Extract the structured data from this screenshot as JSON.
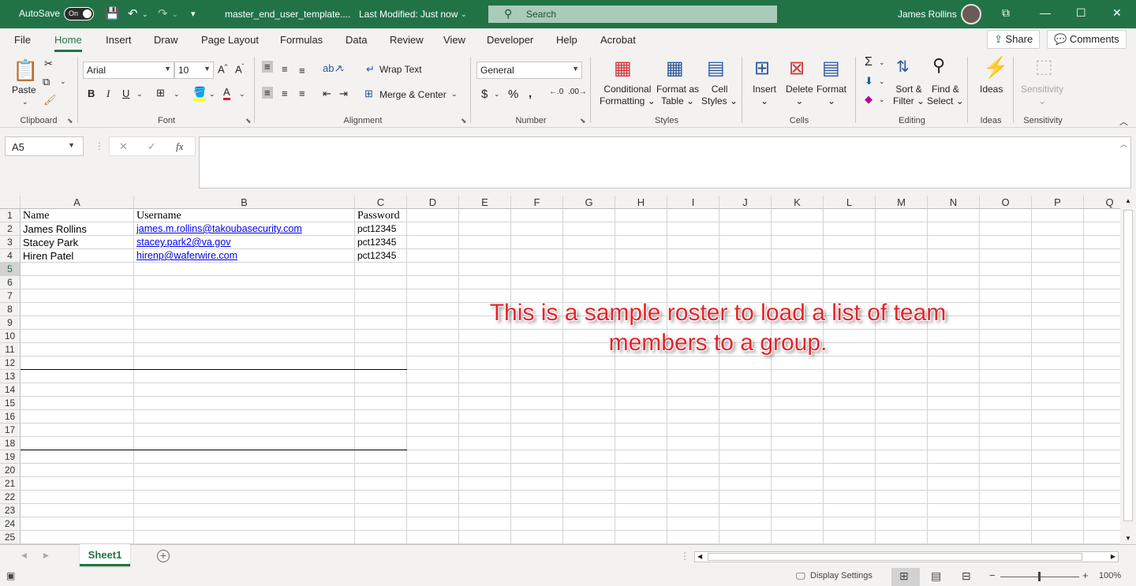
{
  "titlebar": {
    "autosave_label": "AutoSave",
    "autosave_state": "On",
    "filename": "master_end_user_template....",
    "last_modified": "Last Modified: Just now",
    "search_placeholder": "Search",
    "user_name": "James Rollins"
  },
  "menu": {
    "tabs": [
      "File",
      "Home",
      "Insert",
      "Draw",
      "Page Layout",
      "Formulas",
      "Data",
      "Review",
      "View",
      "Developer",
      "Help",
      "Acrobat"
    ],
    "active": "Home",
    "share_label": "Share",
    "comments_label": "Comments"
  },
  "ribbon": {
    "clipboard": {
      "paste": "Paste",
      "label": "Clipboard"
    },
    "font": {
      "name": "Arial",
      "size": "10",
      "label": "Font",
      "bold": "B",
      "italic": "I",
      "underline": "U"
    },
    "alignment": {
      "wrap_text": "Wrap Text",
      "merge_center": "Merge & Center",
      "label": "Alignment"
    },
    "number": {
      "format": "General",
      "label": "Number"
    },
    "styles": {
      "conditional": "Conditional",
      "formatting": "Formatting",
      "format_as": "Format as",
      "table": "Table",
      "cell": "Cell",
      "cell_styles": "Styles",
      "label": "Styles"
    },
    "cells": {
      "insert": "Insert",
      "delete": "Delete",
      "format": "Format",
      "label": "Cells"
    },
    "editing": {
      "sort": "Sort &",
      "filter": "Filter",
      "find": "Find &",
      "select": "Select",
      "label": "Editing"
    },
    "ideas": {
      "ideas": "Ideas",
      "label": "Ideas"
    },
    "sensitivity": {
      "sensitivity": "Sensitivity",
      "label": "Sensitivity"
    }
  },
  "formula_bar": {
    "name_box": "A5",
    "fx": "fx",
    "formula": ""
  },
  "sheet": {
    "columns": [
      "A",
      "B",
      "C",
      "D",
      "E",
      "F",
      "G",
      "H",
      "I",
      "J",
      "K",
      "L",
      "M",
      "N",
      "O",
      "P",
      "Q"
    ],
    "rows": [
      "1",
      "2",
      "3",
      "4",
      "5",
      "6",
      "7",
      "8",
      "9",
      "10",
      "11",
      "12",
      "13",
      "14",
      "15",
      "16",
      "17",
      "18",
      "19",
      "20",
      "21",
      "22",
      "23",
      "24",
      "25"
    ],
    "headers": {
      "name": "Name",
      "username": "Username",
      "password": "Password"
    },
    "data": [
      {
        "name": "James Rollins",
        "username": "james.m.rollins@takoubasecurity.com",
        "password": "pct12345"
      },
      {
        "name": "Stacey Park",
        "username": "stacey.park2@va.gov",
        "password": "pct12345"
      },
      {
        "name": "Hiren Patel",
        "username": "hirenp@waferwire.com",
        "password": "pct12345"
      }
    ],
    "annotation_line1": "This is a sample roster to load a list of team",
    "annotation_line2": "members to a group."
  },
  "sheet_tabs": {
    "active": "Sheet1"
  },
  "statusbar": {
    "display_settings": "Display Settings",
    "zoom": "100%"
  },
  "colors": {
    "excel_green": "#217346",
    "annotation_red": "#e3242b",
    "link_blue": "#0000ee"
  }
}
